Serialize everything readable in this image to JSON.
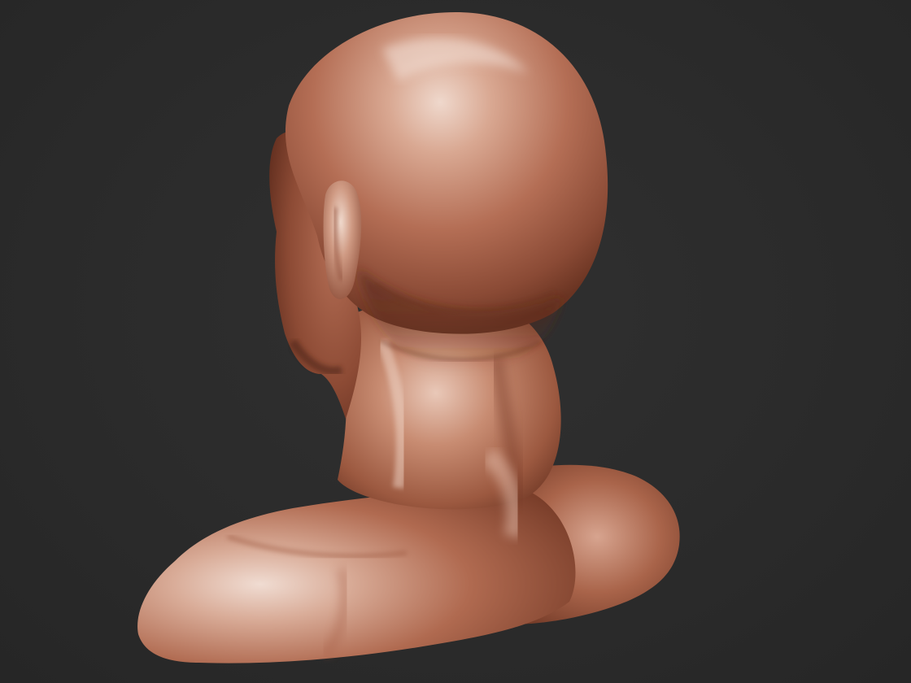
{
  "scene": {
    "background_color": "#2b2b2b",
    "material_colors": {
      "highlight": "#efd8cc",
      "light": "#d9a892",
      "mid": "#b46e55",
      "base": "#8a4a35",
      "shadow": "#5a2a1c"
    },
    "subject": "sculpted-bust-back-view"
  }
}
